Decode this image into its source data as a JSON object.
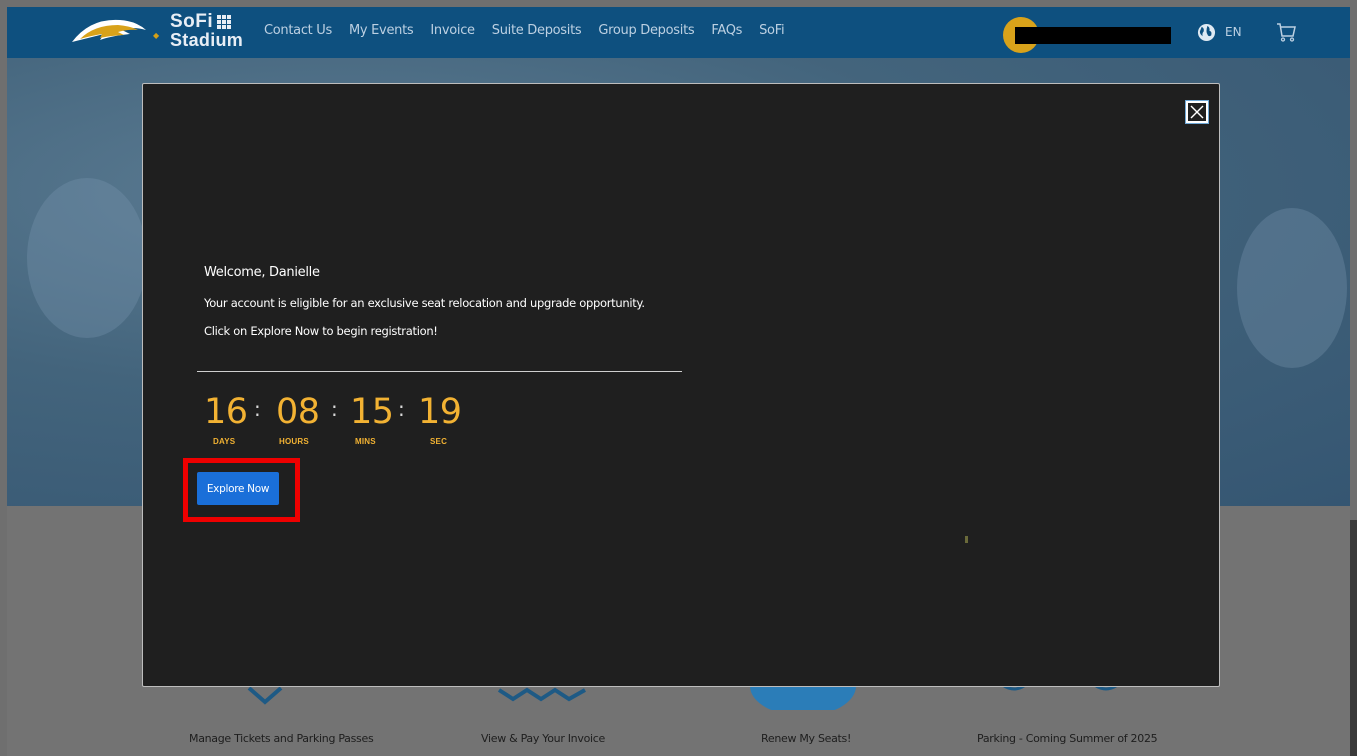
{
  "header": {
    "brand": {
      "line1": "SoFi",
      "line2": "Stadium"
    },
    "nav": [
      "Contact Us",
      "My Events",
      "Invoice",
      "Suite Deposits",
      "Group Deposits",
      "FAQs",
      "SoFi"
    ],
    "language": "EN",
    "icons": [
      "chargers-bolt-logo",
      "avatar",
      "globe-icon",
      "cart-icon"
    ]
  },
  "modal": {
    "welcome": "Welcome, Danielle",
    "message1": "Your account is eligible for an exclusive seat relocation and upgrade opportunity.",
    "message2": "Click on Explore Now to begin registration!",
    "countdown": {
      "days": "16",
      "hours": "08",
      "mins": "15",
      "sec": "19",
      "labels": {
        "days": "DAYS",
        "hours": "HOURS",
        "mins": "MINS",
        "sec": "SEC"
      },
      "separator": ":"
    },
    "explore_label": "Explore Now"
  },
  "cards": [
    "Manage Tickets and Parking Passes",
    "View & Pay Your Invoice",
    "Renew My Seats!",
    "Parking - Coming Summer of 2025"
  ],
  "colors": {
    "header_bg": "#0e507f",
    "modal_bg": "#1f1f1f",
    "countdown": "#f2b233",
    "button": "#1a6fd9",
    "highlight": "#ee0000"
  }
}
